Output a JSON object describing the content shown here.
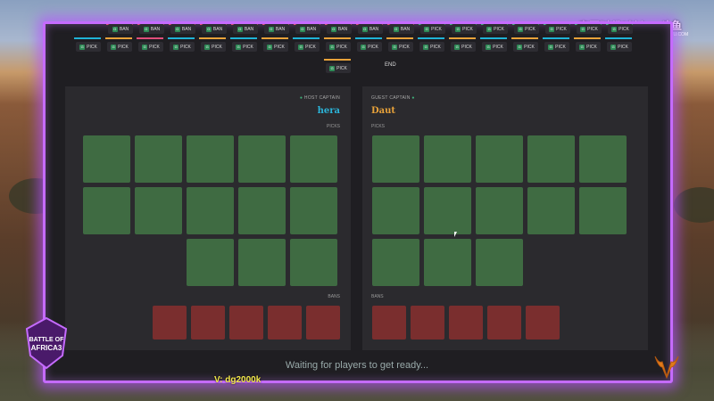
{
  "watermark": {
    "title": "帝国时代2封心",
    "brand": "斗鱼",
    "site": "DOUYU.COM"
  },
  "draft_bar": {
    "top_slots": [
      {
        "label": "BAN",
        "color": "#e04d7a"
      },
      {
        "label": "BAN",
        "color": "#e04d7a"
      },
      {
        "label": "BAN",
        "color": "#e04d7a"
      },
      {
        "label": "BAN",
        "color": "#e04d7a"
      },
      {
        "label": "BAN",
        "color": "#e04d7a"
      },
      {
        "label": "BAN",
        "color": "#e04d7a"
      },
      {
        "label": "BAN",
        "color": "#e04d7a"
      },
      {
        "label": "BAN",
        "color": "#e04d7a"
      },
      {
        "label": "BAN",
        "color": "#e04d7a"
      },
      {
        "label": "BAN",
        "color": "#e04d7a"
      },
      {
        "label": "PICK",
        "color": "#3fb07a"
      },
      {
        "label": "PICK",
        "color": "#3fb07a"
      },
      {
        "label": "PICK",
        "color": "#3fb07a"
      },
      {
        "label": "PICK",
        "color": "#3fb07a"
      },
      {
        "label": "PICK",
        "color": "#3fb07a"
      },
      {
        "label": "PICK",
        "color": "#3fb07a"
      },
      {
        "label": "PICK",
        "color": "#3fb07a"
      }
    ],
    "bottom_slots": [
      {
        "label": "PICK",
        "color": "#1fb3d6"
      },
      {
        "label": "PICK",
        "color": "#e8a23a"
      },
      {
        "label": "PICK",
        "color": "#e04d7a"
      },
      {
        "label": "PICK",
        "color": "#1fb3d6"
      },
      {
        "label": "PICK",
        "color": "#e8a23a"
      },
      {
        "label": "PICK",
        "color": "#1fb3d6"
      },
      {
        "label": "PICK",
        "color": "#e8a23a"
      },
      {
        "label": "PICK",
        "color": "#1fb3d6"
      },
      {
        "label": "PICK",
        "color": "#e8a23a"
      },
      {
        "label": "PICK",
        "color": "#1fb3d6"
      },
      {
        "label": "PICK",
        "color": "#e8a23a"
      },
      {
        "label": "PICK",
        "color": "#1fb3d6"
      },
      {
        "label": "PICK",
        "color": "#e8a23a"
      },
      {
        "label": "PICK",
        "color": "#1fb3d6"
      },
      {
        "label": "PICK",
        "color": "#e8a23a"
      },
      {
        "label": "PICK",
        "color": "#1fb3d6"
      },
      {
        "label": "PICK",
        "color": "#e8a23a"
      },
      {
        "label": "PICK",
        "color": "#1fb3d6"
      }
    ],
    "final_slot": {
      "label": "PICK",
      "color": "#e8a23a"
    },
    "end_label": "END",
    "slot_prefix": "G"
  },
  "host": {
    "caption": "HOST CAPTAIN",
    "name": "hera",
    "name_color": "#2bb4d9",
    "dot_color": "#3fb07a",
    "picks_label": "PICKS",
    "bans_label": "BANS"
  },
  "guest": {
    "caption": "GUEST CAPTAIN",
    "name": "Daut",
    "name_color": "#e8a23a",
    "dot_color": "#3fb07a",
    "picks_label": "PICKS",
    "bans_label": "BANS"
  },
  "status": {
    "waiting": "Waiting for players to get ready..."
  },
  "viewer": {
    "text": "V:  dg2000k"
  },
  "logo": {
    "text": "BATTLE OF AFRICA 3"
  },
  "colors": {
    "frame_glow": "#c56bff",
    "pick_tile": "#3f6b42",
    "ban_tile": "#7a2e2e"
  }
}
